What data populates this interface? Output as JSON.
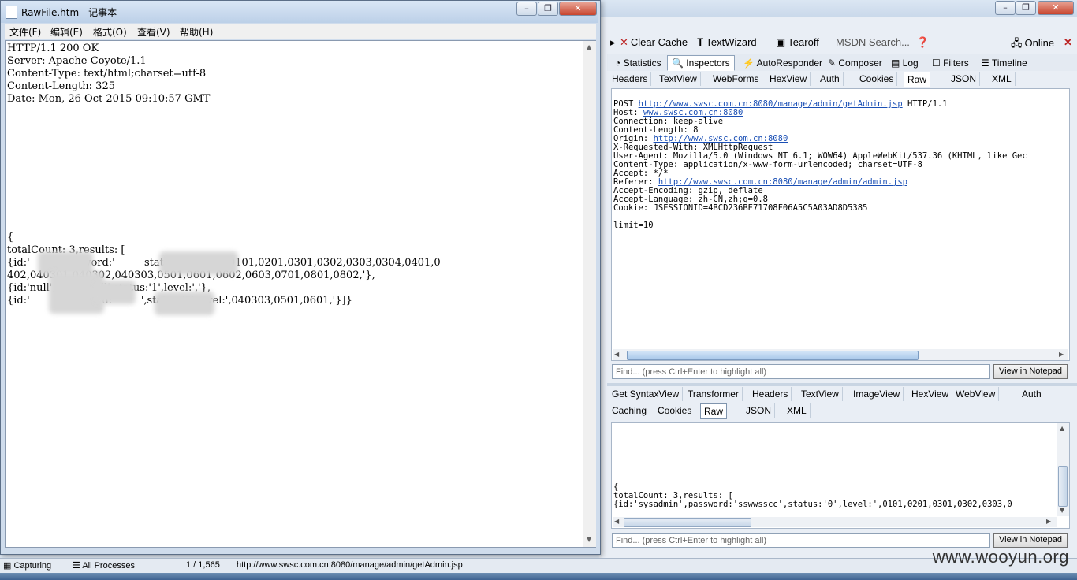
{
  "notepad": {
    "title": "RawFile.htm - 记事本",
    "menu": [
      "文件(F)",
      "编辑(E)",
      "格式(O)",
      "查看(V)",
      "帮助(H)"
    ],
    "headers": [
      "HTTP/1.1 200 OK",
      "Server: Apache-Coyote/1.1",
      "Content-Type: text/html;charset=utf-8",
      "Content-Length: 325",
      "Date: Mon, 26 Oct 2015 09:10:57 GMT"
    ],
    "body": [
      "{",
      "totalCount: 3,results: [",
      "{id:'        ,password:'         status:'0',level:',0101,0201,0301,0302,0303,0304,0401,0",
      "402,040301,040302,040303,0501,0601,0602,0603,0701,0801,0802,'},",
      "{id:'null',p       'null',status:'1',level:','},",
      "{id:'         password:'        ',status:'0',level:',040303,0501,0601,'}]}"
    ]
  },
  "fiddler": {
    "toolbar": {
      "clear_cache": "Clear Cache",
      "textwizard": "TextWizard",
      "tearoff": "Tearoff",
      "msdn_search": "MSDN Search...",
      "online": "Online"
    },
    "main_tabs": [
      "Statistics",
      "Inspectors",
      "AutoResponder",
      "Composer",
      "Log",
      "Filters",
      "Timeline"
    ],
    "request_tabs": [
      "Headers",
      "TextView",
      "WebForms",
      "HexView",
      "Auth",
      "Cookies",
      "Raw",
      "JSON",
      "XML"
    ],
    "request_raw": {
      "line1_method": "POST ",
      "line1_url": "http://www.swsc.com.cn:8080/manage/admin/getAdmin.jsp",
      "line1_proto": " HTTP/1.1",
      "host_label": "Host: ",
      "host_url": "www.swsc.com.cn:8080",
      "connection": "Connection: keep-alive",
      "content_length": "Content-Length: 8",
      "origin_label": "Origin: ",
      "origin_url": "http://www.swsc.com.cn:8080",
      "x_requested": "X-Requested-With: XMLHttpRequest",
      "user_agent": "User-Agent: Mozilla/5.0 (Windows NT 6.1; WOW64) AppleWebKit/537.36 (KHTML, like Gec",
      "content_type": "Content-Type: application/x-www-form-urlencoded; charset=UTF-8",
      "accept": "Accept: */*",
      "referer_label": "Referer: ",
      "referer_url": "http://www.swsc.com.cn:8080/manage/admin/admin.jsp",
      "accept_encoding": "Accept-Encoding: gzip, deflate",
      "accept_language": "Accept-Language: zh-CN,zh;q=0.8",
      "cookie": "Cookie: JSESSIONID=4BCD236BE71708F06A5C5A03AD8D5385",
      "body": "limit=10"
    },
    "find_placeholder": "Find... (press Ctrl+Enter to highlight all)",
    "view_in_notepad": "View in Notepad",
    "response_tabs_row1": [
      "Get SyntaxView",
      "Transformer",
      "Headers",
      "TextView",
      "ImageView",
      "HexView",
      "WebView",
      "Auth"
    ],
    "response_tabs_row2": [
      "Caching",
      "Cookies",
      "Raw",
      "JSON",
      "XML"
    ],
    "response_raw": [
      "{",
      "totalCount: 3,results: [",
      "{id:'sysadmin',password:'sswwsscc',status:'0',level:',0101,0201,0301,0302,0303,0"
    ]
  },
  "statusbar": {
    "capturing": "Capturing",
    "processes": "All Processes",
    "count": "1 / 1,565",
    "url": "http://www.swsc.com.cn:8080/manage/admin/getAdmin.jsp"
  },
  "watermark": "www.wooyun.org"
}
